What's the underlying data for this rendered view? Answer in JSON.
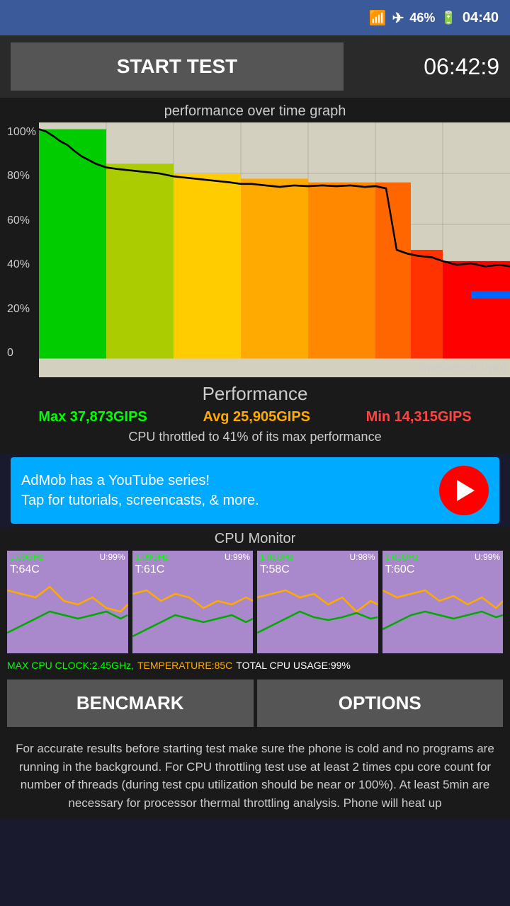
{
  "statusBar": {
    "batteryPercent": "46%",
    "time": "04:40"
  },
  "header": {
    "startTestLabel": "START TEST",
    "timerValue": "06:42:9"
  },
  "graph": {
    "title": "performance over time graph",
    "yLabels": [
      "100%",
      "80%",
      "60%",
      "40%",
      "20%",
      "0"
    ],
    "timeLabel": "time(interval 1min)"
  },
  "performance": {
    "title": "Performance",
    "maxLabel": "Max 37,873GIPS",
    "avgLabel": "Avg 25,905GIPS",
    "minLabel": "Min 14,315GIPS",
    "throttleText": "CPU throttled to 41% of its max performance"
  },
  "adBanner": {
    "line1": "AdMob has a YouTube series!",
    "line2": "Tap for tutorials, screencasts, & more."
  },
  "cpuMonitor": {
    "title": "CPU Monitor",
    "cores": [
      {
        "freq": "1.09GHz",
        "usage": "U:99%",
        "temp": "T:64C"
      },
      {
        "freq": "1.09GHz",
        "usage": "U:99%",
        "temp": "T:61C"
      },
      {
        "freq": "1.01GHz",
        "usage": "U:98%",
        "temp": "T:58C"
      },
      {
        "freq": "1.01GHz",
        "usage": "U:99%",
        "temp": "T:60C"
      }
    ]
  },
  "bottomStats": {
    "clock": "MAX CPU CLOCK:2.45GHz,",
    "temp": "TEMPERATURE:85C",
    "usage": "TOTAL CPU USAGE:99%"
  },
  "buttons": {
    "benchmark": "BENCMARK",
    "options": "OPTIONS"
  },
  "infoText": "For accurate results before starting test make sure the phone is cold and no programs are running in the background. For CPU throttling test use at least 2 times cpu core count for number of threads (during test cpu utilization should be near or 100%). At least 5min are necessary for processor thermal throttling analysis. Phone will heat up"
}
